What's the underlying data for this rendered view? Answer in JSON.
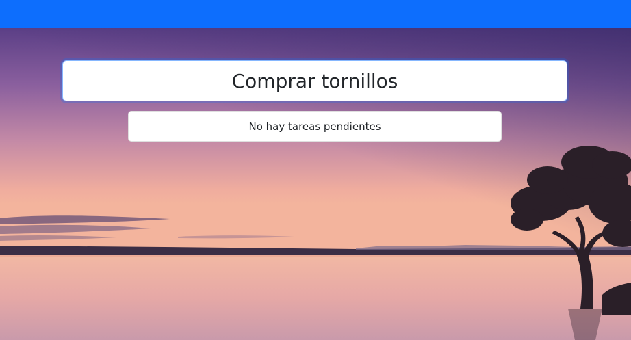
{
  "colors": {
    "navbar": "#0d6efd",
    "input_focus_border": "#86b7fe",
    "text": "#212529"
  },
  "navbar": {},
  "background": {
    "description_icon": "sunset-lake-photo"
  },
  "task_input": {
    "value": "Comprar tornillos",
    "placeholder": ""
  },
  "task_list": {
    "empty_message": "No hay tareas pendientes"
  }
}
